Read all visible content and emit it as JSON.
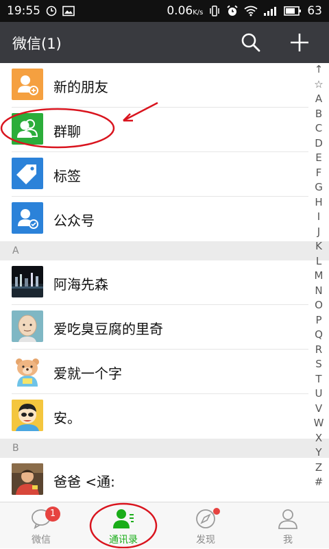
{
  "status_bar": {
    "time": "19:55",
    "network_speed": "0.06",
    "network_unit": "K/s",
    "battery": "63"
  },
  "header": {
    "title": "微信(1)",
    "search_icon": "search-icon",
    "add_icon": "plus-icon"
  },
  "top_items": [
    {
      "label": "新的朋友",
      "icon": "new-friend-icon",
      "color": "#f5a040"
    },
    {
      "label": "群聊",
      "icon": "group-chat-icon",
      "color": "#2bad3a"
    },
    {
      "label": "标签",
      "icon": "tag-icon",
      "color": "#2b82d9"
    },
    {
      "label": "公众号",
      "icon": "official-account-icon",
      "color": "#2b82d9"
    }
  ],
  "sections": [
    {
      "letter": "A",
      "contacts": [
        {
          "name": "阿海先森",
          "avatar": "night-scene-avatar"
        },
        {
          "name": "爱吃臭豆腐的里奇",
          "avatar": "bald-cartoon-avatar"
        },
        {
          "name": "爱就一个字",
          "avatar": "bear-cartoon-avatar"
        },
        {
          "name": "安。",
          "avatar": "cartoon-boy-avatar"
        }
      ]
    },
    {
      "letter": "B",
      "contacts": [
        {
          "name": "爸爸 <通:",
          "avatar": "boy-photo-avatar"
        }
      ]
    }
  ],
  "index_letters": [
    "↑",
    "☆",
    "A",
    "B",
    "C",
    "D",
    "E",
    "F",
    "G",
    "H",
    "I",
    "J",
    "K",
    "L",
    "M",
    "N",
    "O",
    "P",
    "Q",
    "R",
    "S",
    "T",
    "U",
    "V",
    "W",
    "X",
    "Y",
    "Z",
    "#"
  ],
  "tabs": [
    {
      "label": "微信",
      "icon": "chat-bubble-icon",
      "badge": "1",
      "active": false
    },
    {
      "label": "通讯录",
      "icon": "contacts-icon",
      "active": true
    },
    {
      "label": "发现",
      "icon": "compass-icon",
      "dot": true,
      "active": false
    },
    {
      "label": "我",
      "icon": "person-icon",
      "active": false
    }
  ],
  "colors": {
    "header_bg": "#393a3f",
    "accent_green": "#1aad19",
    "badge_red": "#e64340",
    "annotation_red": "#d9141e"
  }
}
